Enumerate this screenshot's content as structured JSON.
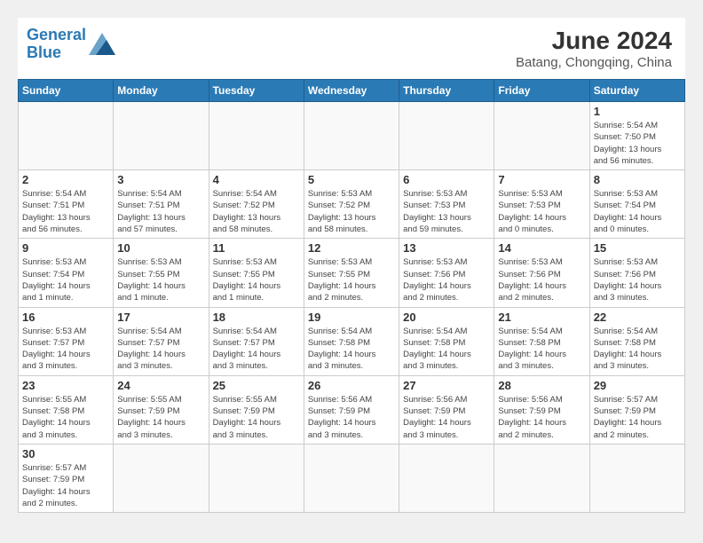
{
  "header": {
    "logo_general": "General",
    "logo_blue": "Blue",
    "month_year": "June 2024",
    "location": "Batang, Chongqing, China"
  },
  "days_of_week": [
    "Sunday",
    "Monday",
    "Tuesday",
    "Wednesday",
    "Thursday",
    "Friday",
    "Saturday"
  ],
  "weeks": [
    [
      {
        "day": "",
        "info": ""
      },
      {
        "day": "",
        "info": ""
      },
      {
        "day": "",
        "info": ""
      },
      {
        "day": "",
        "info": ""
      },
      {
        "day": "",
        "info": ""
      },
      {
        "day": "",
        "info": ""
      },
      {
        "day": "1",
        "info": "Sunrise: 5:54 AM\nSunset: 7:50 PM\nDaylight: 13 hours\nand 56 minutes."
      }
    ],
    [
      {
        "day": "2",
        "info": "Sunrise: 5:54 AM\nSunset: 7:51 PM\nDaylight: 13 hours\nand 56 minutes."
      },
      {
        "day": "3",
        "info": "Sunrise: 5:54 AM\nSunset: 7:51 PM\nDaylight: 13 hours\nand 57 minutes."
      },
      {
        "day": "4",
        "info": "Sunrise: 5:54 AM\nSunset: 7:52 PM\nDaylight: 13 hours\nand 58 minutes."
      },
      {
        "day": "5",
        "info": "Sunrise: 5:53 AM\nSunset: 7:52 PM\nDaylight: 13 hours\nand 58 minutes."
      },
      {
        "day": "6",
        "info": "Sunrise: 5:53 AM\nSunset: 7:53 PM\nDaylight: 13 hours\nand 59 minutes."
      },
      {
        "day": "7",
        "info": "Sunrise: 5:53 AM\nSunset: 7:53 PM\nDaylight: 14 hours\nand 0 minutes."
      },
      {
        "day": "8",
        "info": "Sunrise: 5:53 AM\nSunset: 7:54 PM\nDaylight: 14 hours\nand 0 minutes."
      }
    ],
    [
      {
        "day": "9",
        "info": "Sunrise: 5:53 AM\nSunset: 7:54 PM\nDaylight: 14 hours\nand 1 minute."
      },
      {
        "day": "10",
        "info": "Sunrise: 5:53 AM\nSunset: 7:55 PM\nDaylight: 14 hours\nand 1 minute."
      },
      {
        "day": "11",
        "info": "Sunrise: 5:53 AM\nSunset: 7:55 PM\nDaylight: 14 hours\nand 1 minute."
      },
      {
        "day": "12",
        "info": "Sunrise: 5:53 AM\nSunset: 7:55 PM\nDaylight: 14 hours\nand 2 minutes."
      },
      {
        "day": "13",
        "info": "Sunrise: 5:53 AM\nSunset: 7:56 PM\nDaylight: 14 hours\nand 2 minutes."
      },
      {
        "day": "14",
        "info": "Sunrise: 5:53 AM\nSunset: 7:56 PM\nDaylight: 14 hours\nand 2 minutes."
      },
      {
        "day": "15",
        "info": "Sunrise: 5:53 AM\nSunset: 7:56 PM\nDaylight: 14 hours\nand 3 minutes."
      }
    ],
    [
      {
        "day": "16",
        "info": "Sunrise: 5:53 AM\nSunset: 7:57 PM\nDaylight: 14 hours\nand 3 minutes."
      },
      {
        "day": "17",
        "info": "Sunrise: 5:54 AM\nSunset: 7:57 PM\nDaylight: 14 hours\nand 3 minutes."
      },
      {
        "day": "18",
        "info": "Sunrise: 5:54 AM\nSunset: 7:57 PM\nDaylight: 14 hours\nand 3 minutes."
      },
      {
        "day": "19",
        "info": "Sunrise: 5:54 AM\nSunset: 7:58 PM\nDaylight: 14 hours\nand 3 minutes."
      },
      {
        "day": "20",
        "info": "Sunrise: 5:54 AM\nSunset: 7:58 PM\nDaylight: 14 hours\nand 3 minutes."
      },
      {
        "day": "21",
        "info": "Sunrise: 5:54 AM\nSunset: 7:58 PM\nDaylight: 14 hours\nand 3 minutes."
      },
      {
        "day": "22",
        "info": "Sunrise: 5:54 AM\nSunset: 7:58 PM\nDaylight: 14 hours\nand 3 minutes."
      }
    ],
    [
      {
        "day": "23",
        "info": "Sunrise: 5:55 AM\nSunset: 7:58 PM\nDaylight: 14 hours\nand 3 minutes."
      },
      {
        "day": "24",
        "info": "Sunrise: 5:55 AM\nSunset: 7:59 PM\nDaylight: 14 hours\nand 3 minutes."
      },
      {
        "day": "25",
        "info": "Sunrise: 5:55 AM\nSunset: 7:59 PM\nDaylight: 14 hours\nand 3 minutes."
      },
      {
        "day": "26",
        "info": "Sunrise: 5:56 AM\nSunset: 7:59 PM\nDaylight: 14 hours\nand 3 minutes."
      },
      {
        "day": "27",
        "info": "Sunrise: 5:56 AM\nSunset: 7:59 PM\nDaylight: 14 hours\nand 3 minutes."
      },
      {
        "day": "28",
        "info": "Sunrise: 5:56 AM\nSunset: 7:59 PM\nDaylight: 14 hours\nand 2 minutes."
      },
      {
        "day": "29",
        "info": "Sunrise: 5:57 AM\nSunset: 7:59 PM\nDaylight: 14 hours\nand 2 minutes."
      }
    ],
    [
      {
        "day": "30",
        "info": "Sunrise: 5:57 AM\nSunset: 7:59 PM\nDaylight: 14 hours\nand 2 minutes."
      },
      {
        "day": "",
        "info": ""
      },
      {
        "day": "",
        "info": ""
      },
      {
        "day": "",
        "info": ""
      },
      {
        "day": "",
        "info": ""
      },
      {
        "day": "",
        "info": ""
      },
      {
        "day": "",
        "info": ""
      }
    ]
  ]
}
